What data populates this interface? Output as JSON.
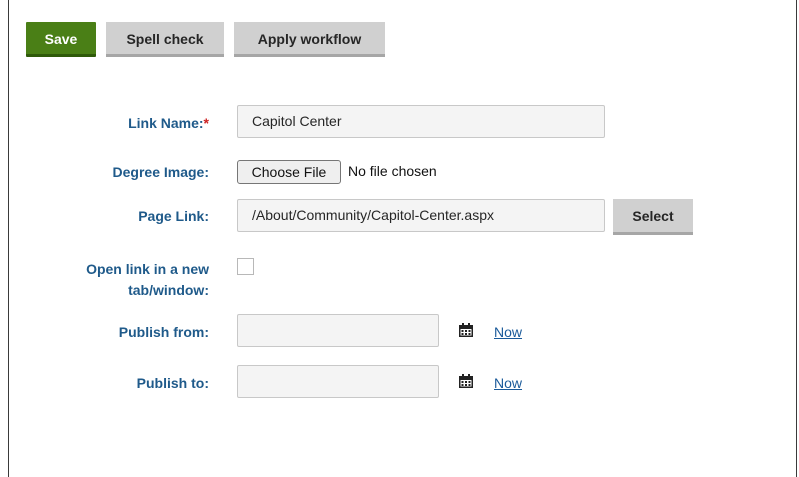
{
  "toolbar": {
    "save_label": "Save",
    "spellcheck_label": "Spell check",
    "apply_workflow_label": "Apply workflow"
  },
  "form": {
    "link_name": {
      "label": "Link Name:",
      "required_marker": "*",
      "value": "Capitol Center"
    },
    "degree_image": {
      "label": "Degree Image:",
      "choose_file_label": "Choose File",
      "file_status": "No file chosen"
    },
    "page_link": {
      "label": "Page Link:",
      "value": "/About/Community/Capitol-Center.aspx",
      "select_label": "Select"
    },
    "open_new_tab": {
      "label_line1": "Open link in a new",
      "label_line2": "tab/window:",
      "checked": false
    },
    "publish_from": {
      "label": "Publish from:",
      "value": "",
      "now_label": "Now"
    },
    "publish_to": {
      "label": "Publish to:",
      "value": "",
      "now_label": "Now"
    }
  },
  "icons": {
    "calendar": "calendar-icon"
  }
}
